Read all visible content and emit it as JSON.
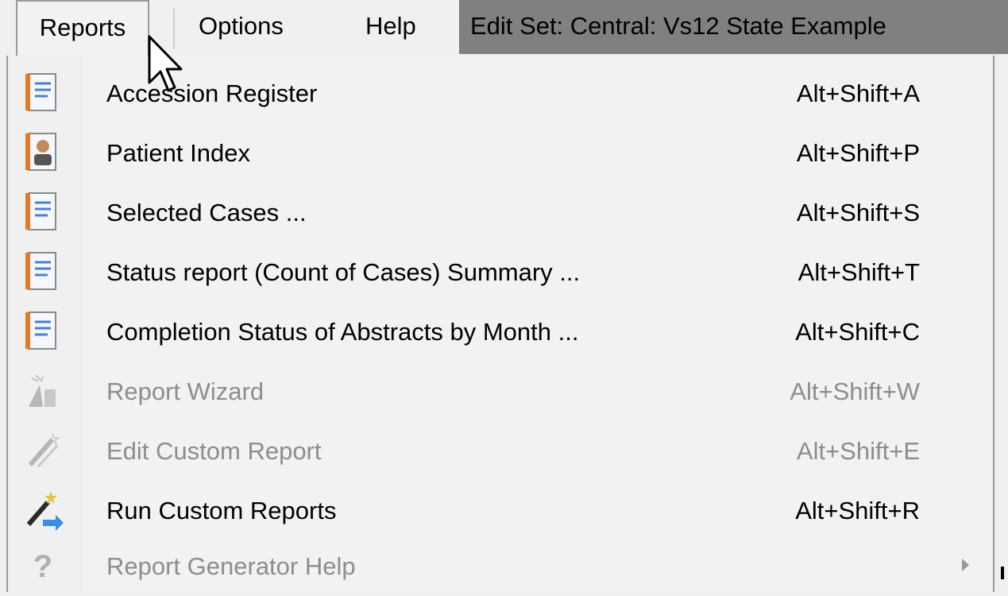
{
  "menubar": {
    "reports": "Reports",
    "options": "Options",
    "help": "Help",
    "edit_set": "Edit Set: Central: Vs12 State Example"
  },
  "menu": {
    "items": [
      {
        "label": "Accession Register",
        "shortcut": "Alt+Shift+A",
        "icon": "report-doc-icon",
        "enabled": true
      },
      {
        "label": "Patient Index",
        "shortcut": "Alt+Shift+P",
        "icon": "patient-report-icon",
        "enabled": true
      },
      {
        "label": "Selected Cases ...",
        "shortcut": "Alt+Shift+S",
        "icon": "report-doc-icon",
        "enabled": true
      },
      {
        "label": "Status report (Count of Cases) Summary ...",
        "shortcut": "Alt+Shift+T",
        "icon": "report-doc-icon",
        "enabled": true
      },
      {
        "label": "Completion Status of Abstracts by Month ...",
        "shortcut": "Alt+Shift+C",
        "icon": "report-doc-icon",
        "enabled": true
      },
      {
        "label": "Report Wizard",
        "shortcut": "Alt+Shift+W",
        "icon": "wizard-hat-icon",
        "enabled": false
      },
      {
        "label": "Edit Custom Report",
        "shortcut": "Alt+Shift+E",
        "icon": "magic-wand-icon",
        "enabled": false
      },
      {
        "label": "Run Custom Reports",
        "shortcut": "Alt+Shift+R",
        "icon": "magic-wand-run-icon",
        "enabled": true
      },
      {
        "label": "Report Generator Help",
        "shortcut": "",
        "icon": "help-question-icon",
        "enabled": false,
        "submenu": true
      }
    ]
  },
  "colors": {
    "menu_bg": "#f2f2f2",
    "editset_bg": "#808080",
    "disabled_text": "#8d8d8d"
  }
}
